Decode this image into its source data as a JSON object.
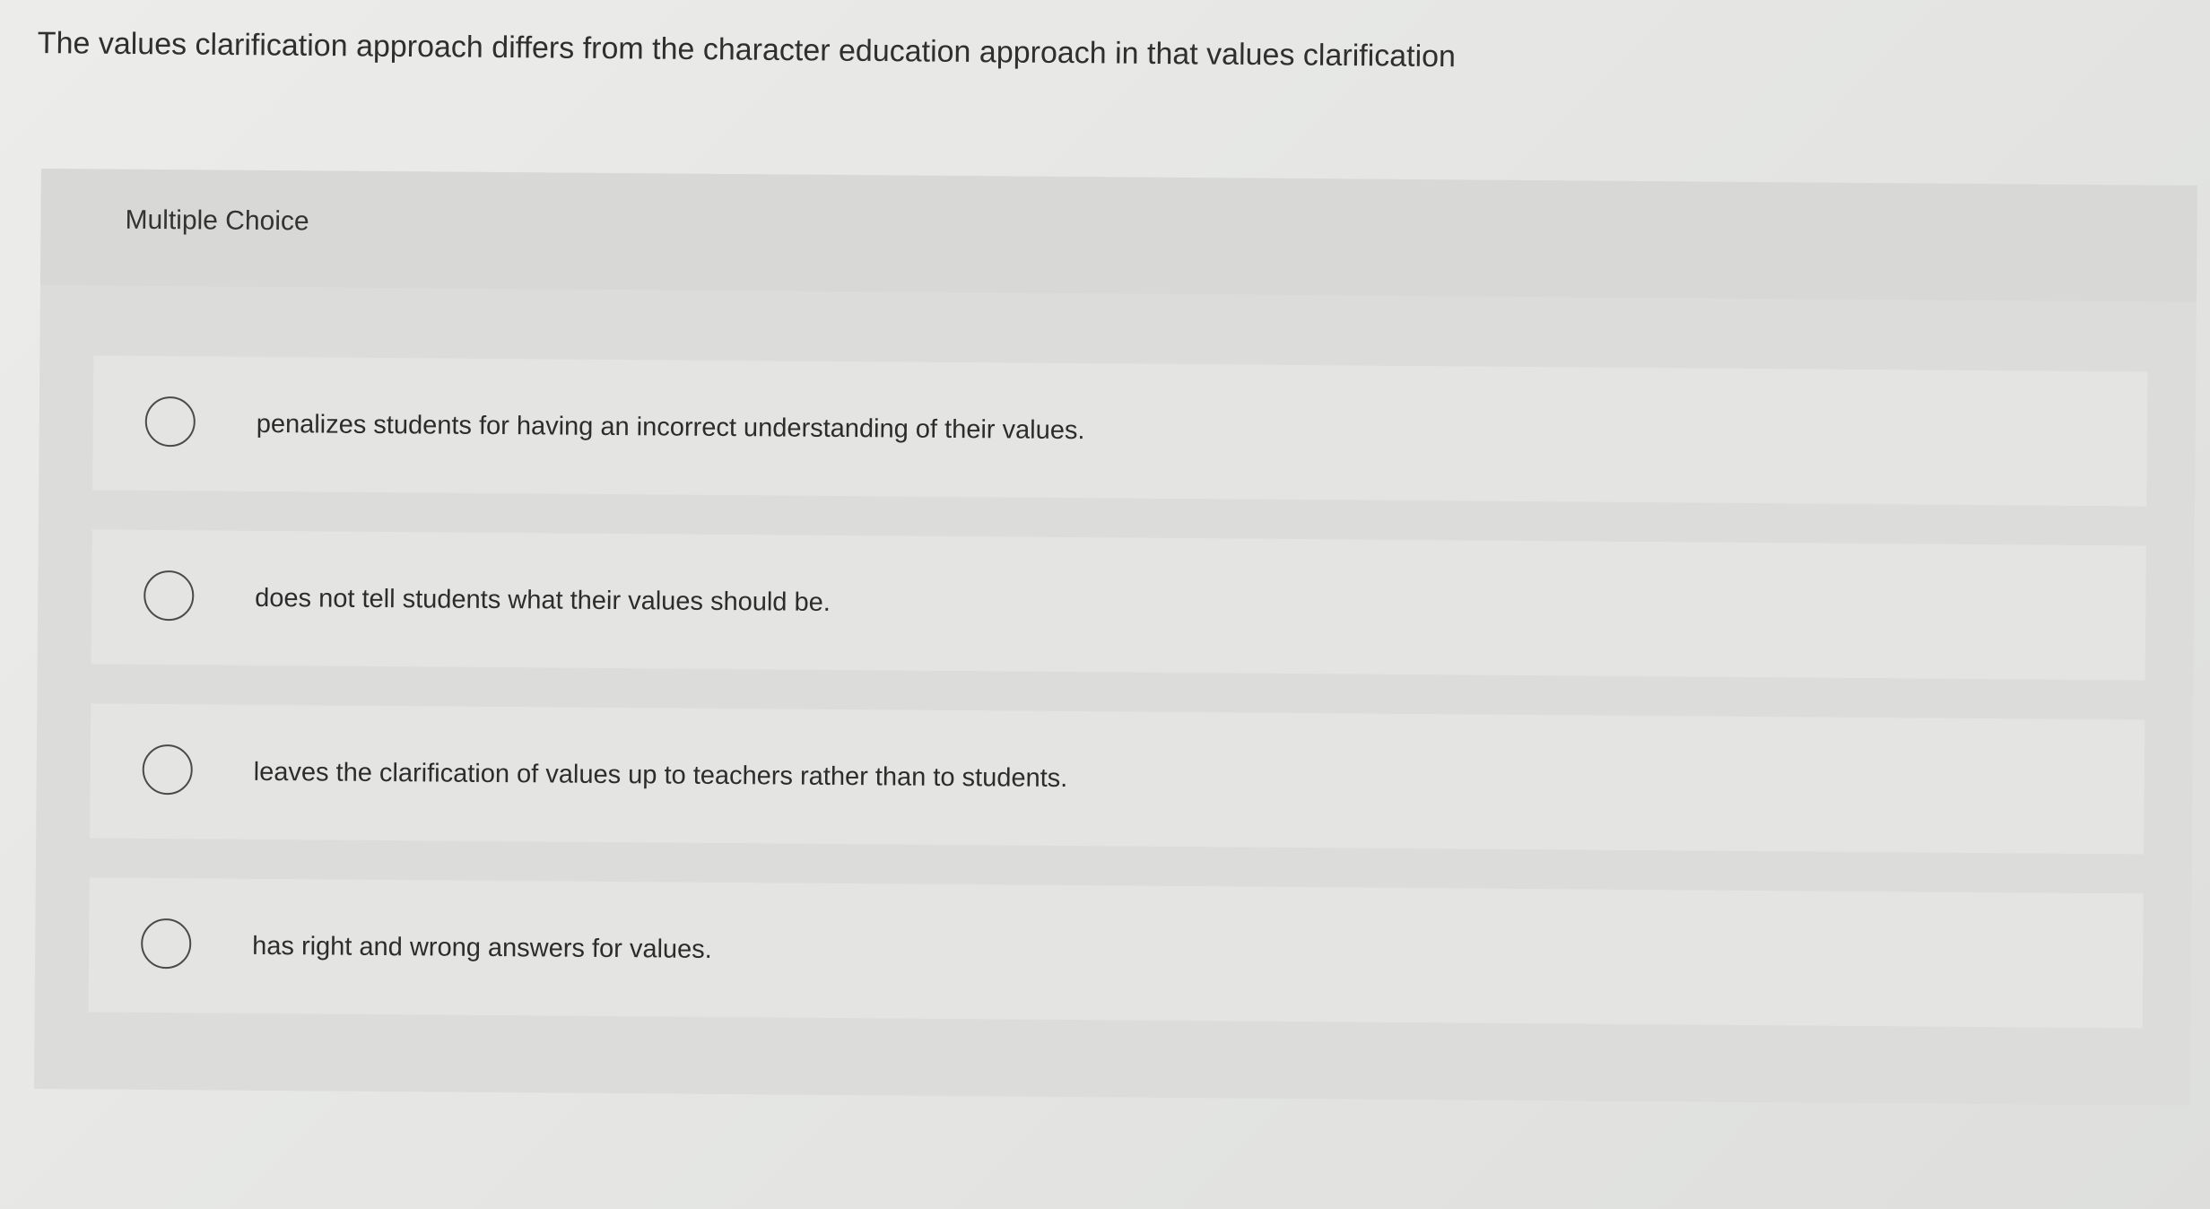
{
  "question": {
    "text": "The values clarification approach differs from the character education approach in that values clarification"
  },
  "multiple_choice": {
    "label": "Multiple Choice",
    "options": [
      {
        "text": "penalizes students for having an incorrect understanding of their values.",
        "selected": false
      },
      {
        "text": "does not tell students what their values should be.",
        "selected": false
      },
      {
        "text": "leaves the clarification of values up to teachers rather than to students.",
        "selected": false
      },
      {
        "text": "has right and wrong answers for values.",
        "selected": false
      }
    ]
  }
}
